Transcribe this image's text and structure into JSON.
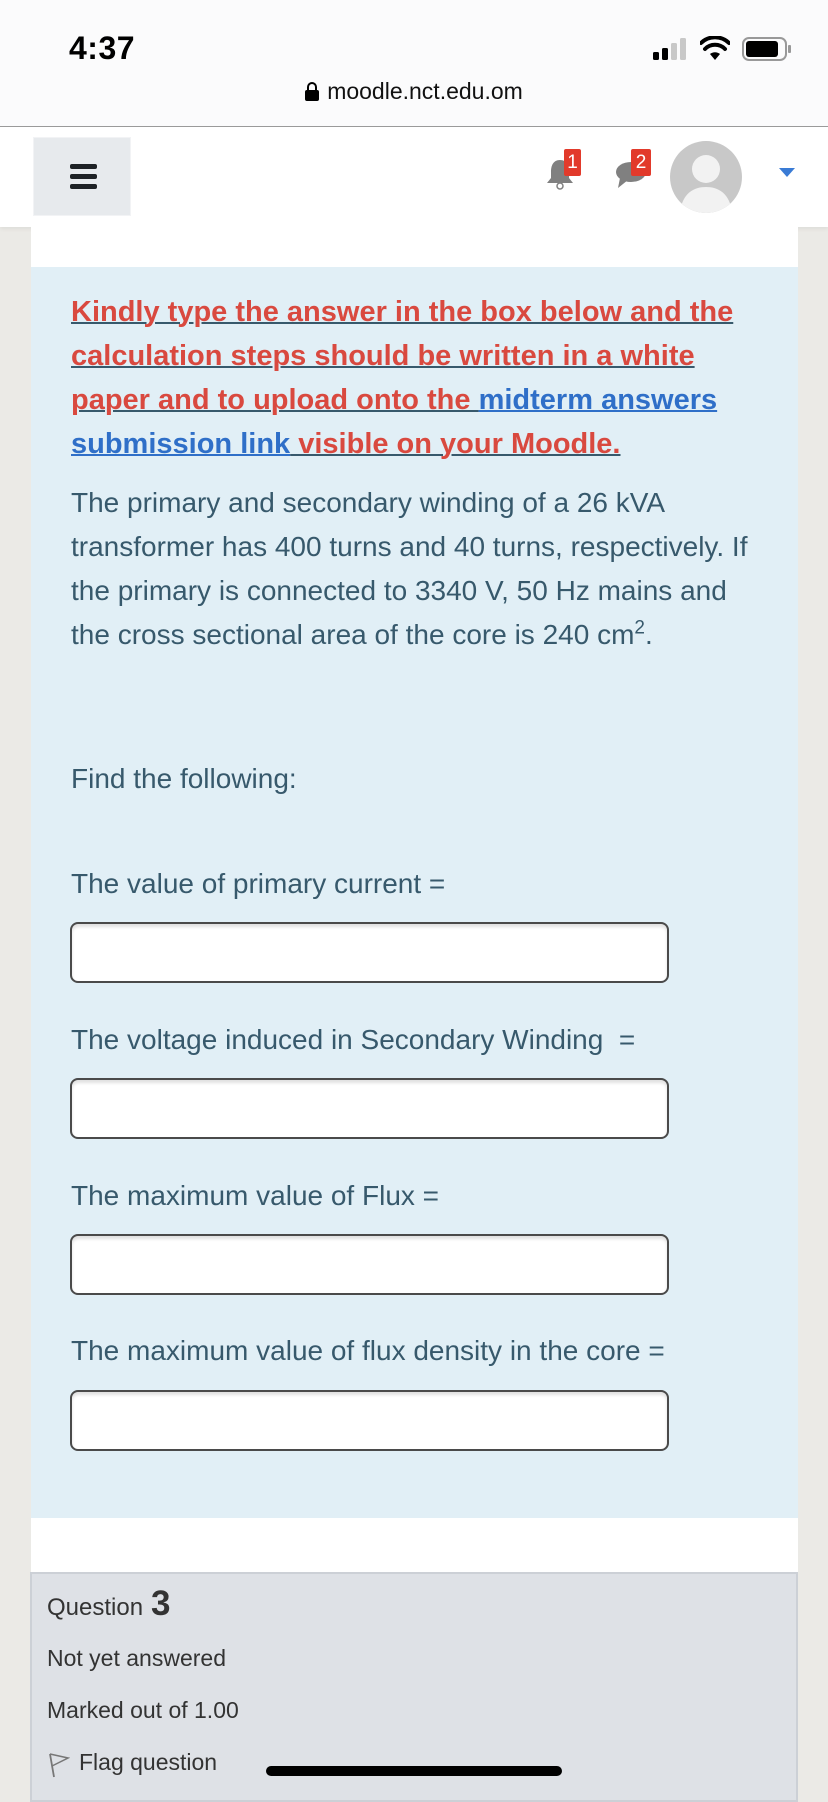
{
  "status_bar": {
    "time": "4:37",
    "icons": [
      "signal-icon",
      "wifi-icon",
      "battery-icon"
    ]
  },
  "browser": {
    "url": "moodle.nct.edu.om",
    "secure_icon": "lock-icon"
  },
  "navbar": {
    "menu_icon": "hamburger-icon",
    "notifications": {
      "icon": "bell-icon",
      "count": "1"
    },
    "messages": {
      "icon": "chat-icon",
      "count": "2"
    },
    "user_menu": {
      "icon": "avatar",
      "caret": "caret-down-icon"
    }
  },
  "question": {
    "instruction": {
      "part1": "Kindly type the answer in the box below and the calculation steps should be written in a white paper and to upload onto the ",
      "link": "midterm answers submission link",
      "part2": " visible on your Moodle."
    },
    "problem": "The primary and secondary winding of a 26 kVA transformer has 400 turns and 40 turns, respectively. If the primary is connected to 3340 V, 50 Hz mains and the cross sectional area of the core is 240 cm",
    "problem_sup": "2",
    "problem_end": ".",
    "find": "Find the following:",
    "fields": [
      {
        "label": "The value of primary current =",
        "value": ""
      },
      {
        "label": "The voltage induced in Secondary Winding  =",
        "value": ""
      },
      {
        "label": "The maximum value of Flux =",
        "value": ""
      },
      {
        "label": "The maximum value of flux density in the core =",
        "value": ""
      }
    ]
  },
  "next_question": {
    "prefix": "Question",
    "number": "3",
    "state": "Not yet answered",
    "marks": "Marked out of 1.00",
    "flag_label": "Flag question"
  },
  "colors": {
    "instruction_red": "#d9493f",
    "link_blue": "#2f6fc8",
    "question_bg": "#e1eff6",
    "badge_red": "#e23a2b"
  }
}
